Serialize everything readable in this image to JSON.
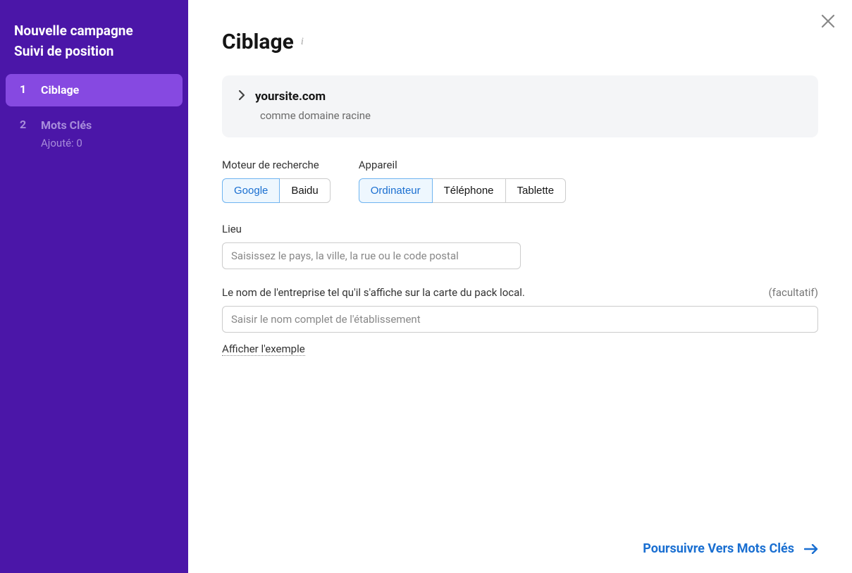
{
  "sidebar": {
    "title_line1": "Nouvelle campagne",
    "title_line2": "Suivi de position",
    "steps": [
      {
        "num": "1",
        "label": "Ciblage",
        "sub": "",
        "active": true
      },
      {
        "num": "2",
        "label": "Mots Clés",
        "sub": "Ajouté: 0",
        "active": false
      }
    ]
  },
  "page": {
    "title": "Ciblage"
  },
  "domain": {
    "name": "yoursite.com",
    "subtitle": "comme domaine racine"
  },
  "search_engine": {
    "label": "Moteur de recherche",
    "options": [
      "Google",
      "Baidu"
    ],
    "selected": "Google"
  },
  "device": {
    "label": "Appareil",
    "options": [
      "Ordinateur",
      "Téléphone",
      "Tablette"
    ],
    "selected": "Ordinateur"
  },
  "location": {
    "label": "Lieu",
    "placeholder": "Saisissez le pays, la ville, la rue ou le code postal"
  },
  "business": {
    "label": "Le nom de l'entreprise tel qu'il s'affiche sur la carte du pack local.",
    "optional": "(facultatif)",
    "placeholder": "Saisir le nom complet de l'établissement",
    "example_link": "Afficher l'exemple"
  },
  "footer": {
    "continue": "Poursuivre Vers Mots Clés"
  }
}
